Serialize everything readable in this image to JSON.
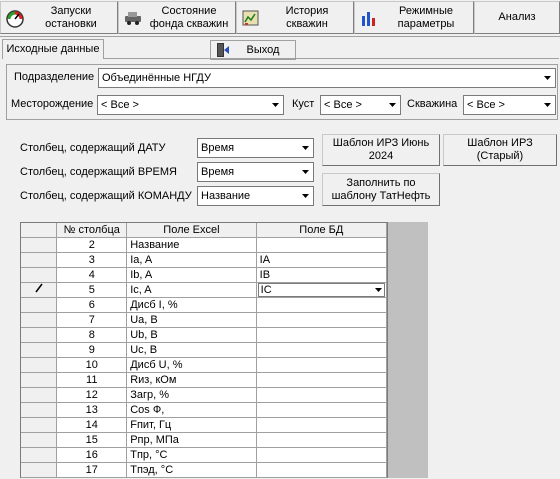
{
  "toolbar": {
    "buttons": [
      {
        "label": "Запуски\nостановки",
        "icon": "gauge-icon"
      },
      {
        "label": "Состояние\nфонда скважин",
        "icon": "car-icon"
      },
      {
        "label": "История\nскважин",
        "icon": "history-icon"
      },
      {
        "label": "Режимные\nпараметры",
        "icon": "bar-chart-icon"
      },
      {
        "label": "Анализ",
        "icon": ""
      }
    ]
  },
  "tab": {
    "label": "Исходные данные"
  },
  "exit": {
    "label": "Выход",
    "icon": "exit-icon"
  },
  "filters": {
    "division_label": "Подразделение",
    "division_value": "Объединённые НГДУ",
    "field_label": "Месторождение",
    "field_value": "< Все >",
    "cluster_label": "Куст",
    "cluster_value": "< Все >",
    "well_label": "Скважина",
    "well_value": "< Все >"
  },
  "columns": {
    "date_label": "Столбец, содержащий ДАТУ",
    "date_value": "Время",
    "time_label": "Столбец, содержащий ВРЕМЯ",
    "time_value": "Время",
    "command_label": "Столбец, содержащий КОМАНДУ",
    "command_value": "Название"
  },
  "buttons": {
    "template_june": "Шаблон ИРЗ Июнь\n2024",
    "template_old": "Шаблон ИРЗ\n(Старый)",
    "fill_tatneft": "Заполнить по\nшаблону ТатНефть"
  },
  "grid": {
    "headers": [
      "№ столбца",
      "Поле Excel",
      "Поле БД"
    ],
    "rows": [
      {
        "num": "2",
        "excel": "Название",
        "db": ""
      },
      {
        "num": "3",
        "excel": "Ia, A",
        "db": "IA"
      },
      {
        "num": "4",
        "excel": "Ib, A",
        "db": "IB"
      },
      {
        "num": "5",
        "excel": "Ic, A",
        "db": "IC",
        "editing": true
      },
      {
        "num": "6",
        "excel": "Дисб I, %",
        "db": ""
      },
      {
        "num": "7",
        "excel": "Ua, B",
        "db": ""
      },
      {
        "num": "8",
        "excel": "Ub, B",
        "db": ""
      },
      {
        "num": "9",
        "excel": "Uc, B",
        "db": ""
      },
      {
        "num": "10",
        "excel": "Дисб U, %",
        "db": ""
      },
      {
        "num": "11",
        "excel": "Rиз, кОм",
        "db": ""
      },
      {
        "num": "12",
        "excel": "Загр, %",
        "db": ""
      },
      {
        "num": "13",
        "excel": "Cos Ф,",
        "db": ""
      },
      {
        "num": "14",
        "excel": "Fпит, Гц",
        "db": ""
      },
      {
        "num": "15",
        "excel": "Pпр, МПа",
        "db": ""
      },
      {
        "num": "16",
        "excel": "Tпр, °C",
        "db": ""
      },
      {
        "num": "17",
        "excel": "Tпэд, °C",
        "db": ""
      }
    ]
  }
}
